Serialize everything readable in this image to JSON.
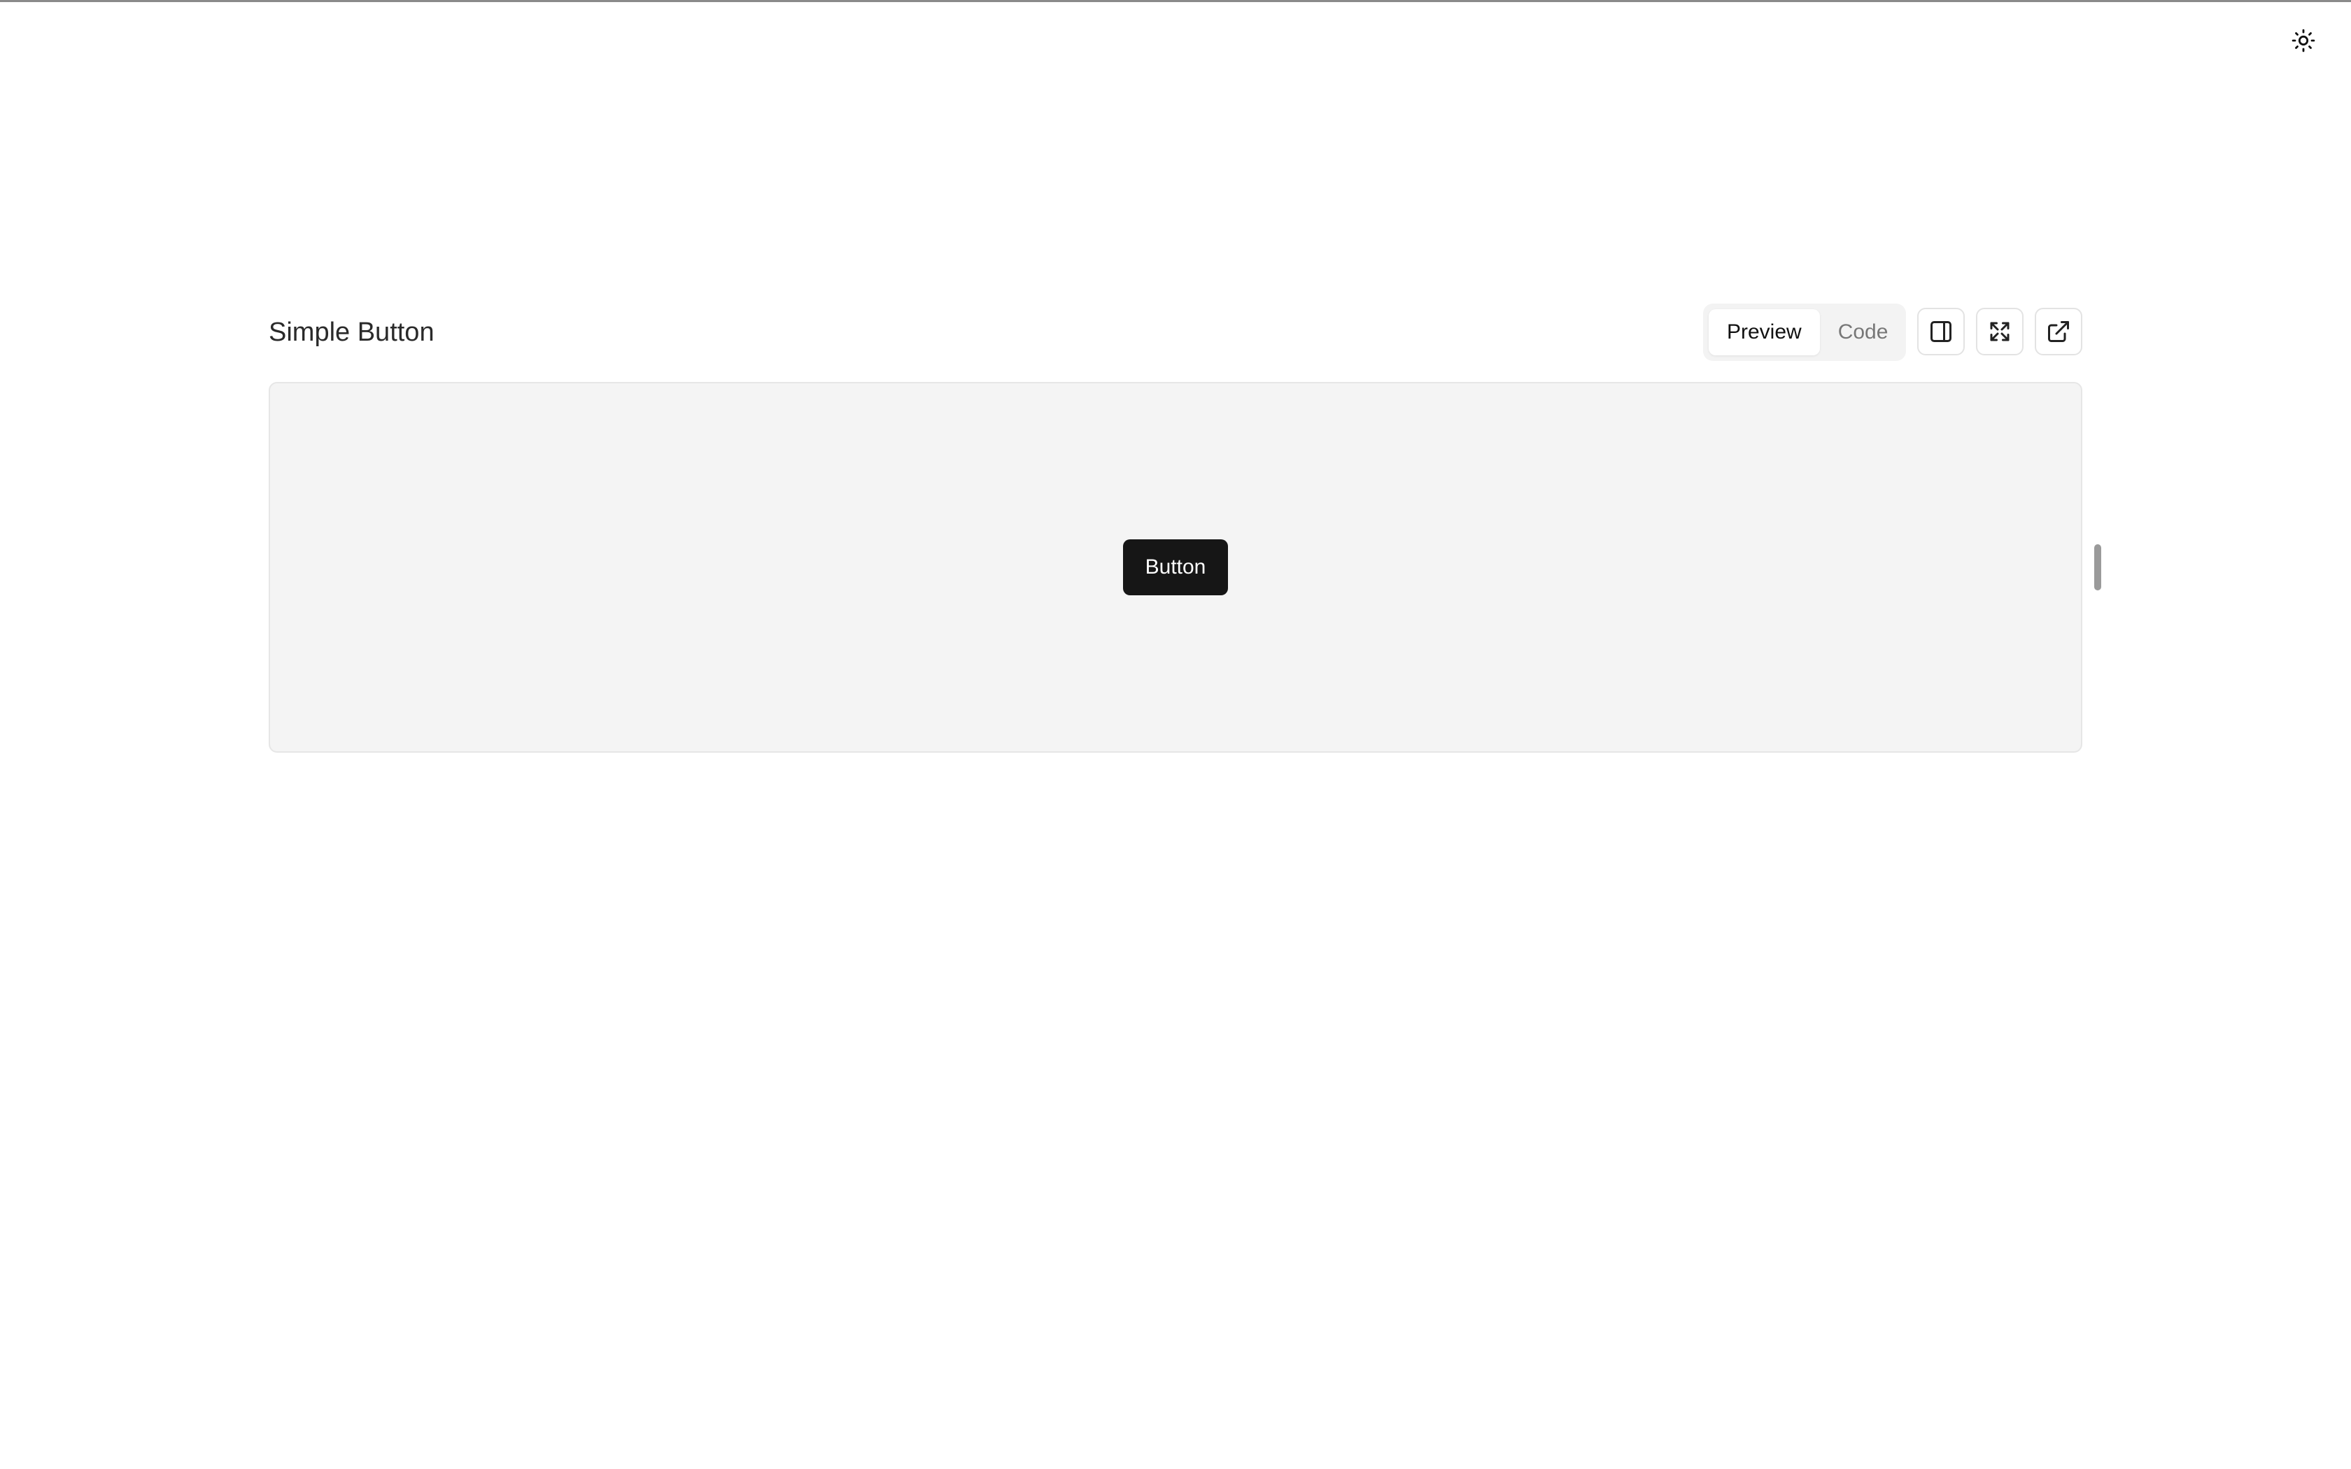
{
  "page": {
    "title": "Simple Button"
  },
  "tabs": [
    {
      "label": "Preview",
      "active": true
    },
    {
      "label": "Code",
      "active": false
    }
  ],
  "toolbar": {
    "icons": [
      "panel-right-icon",
      "expand-icon",
      "external-link-icon"
    ]
  },
  "header_controls": {
    "theme_icon": "sun-icon"
  },
  "preview": {
    "button_label": "Button"
  },
  "colors": {
    "button_bg": "#161616",
    "button_text": "#ffffff",
    "preview_bg": "#f4f4f4"
  }
}
